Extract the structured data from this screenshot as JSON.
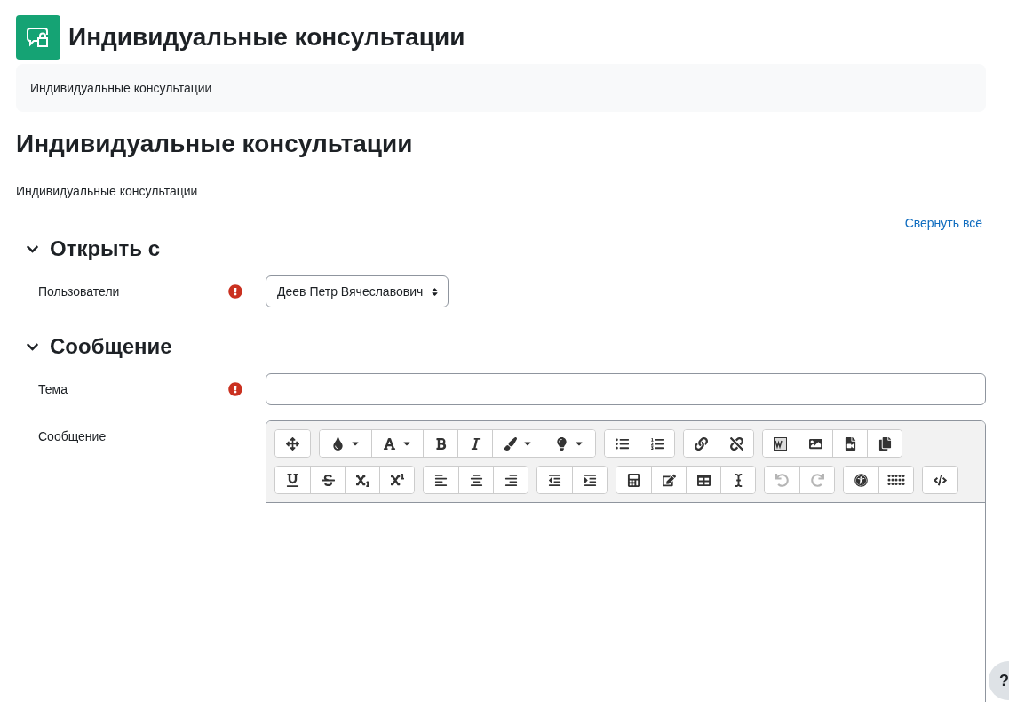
{
  "header": {
    "title": "Индивидуальные консультации"
  },
  "description_box": {
    "text": "Индивидуальные консультации"
  },
  "heading": "Индивидуальные консультации",
  "intro": "Индивидуальные консультации",
  "collapse_link": "Свернуть всё",
  "sections": [
    {
      "title": "Открыть с",
      "expanded": true,
      "fields": [
        {
          "kind": "select",
          "label": "Пользователи",
          "required": true,
          "value": "Деев Петр Вячеславович"
        }
      ]
    },
    {
      "title": "Сообщение",
      "expanded": true,
      "fields": [
        {
          "kind": "text",
          "label": "Тема",
          "required": true
        },
        {
          "kind": "editor",
          "label": "Сообщение",
          "required": false,
          "toolbar": [
            [
              [
                {
                  "dropdown": false,
                  "disabled": false
                }
              ],
              [
                {
                  "dropdown": true,
                  "disabled": false
                },
                {
                  "dropdown": true,
                  "disabled": false
                },
                {
                  "dropdown": false,
                  "disabled": false
                },
                {
                  "dropdown": false,
                  "disabled": false
                },
                {
                  "dropdown": true,
                  "disabled": false
                },
                {
                  "dropdown": true,
                  "disabled": false
                }
              ],
              [
                {
                  "dropdown": false,
                  "disabled": false
                },
                {
                  "dropdown": false,
                  "disabled": false
                }
              ],
              [
                {
                  "dropdown": false,
                  "disabled": false
                },
                {
                  "dropdown": false,
                  "disabled": false
                }
              ],
              [
                {
                  "dropdown": false,
                  "disabled": false
                },
                {
                  "dropdown": false,
                  "disabled": false
                },
                {
                  "dropdown": false,
                  "disabled": false
                },
                {
                  "dropdown": false,
                  "disabled": false
                }
              ]
            ],
            [
              [
                {
                  "dropdown": false,
                  "disabled": false
                },
                {
                  "dropdown": false,
                  "disabled": false
                },
                {
                  "dropdown": false,
                  "disabled": false
                },
                {
                  "dropdown": false,
                  "disabled": false
                }
              ],
              [
                {
                  "dropdown": false,
                  "disabled": false
                },
                {
                  "dropdown": false,
                  "disabled": false
                },
                {
                  "dropdown": false,
                  "disabled": false
                }
              ],
              [
                {
                  "dropdown": false,
                  "disabled": false
                },
                {
                  "dropdown": false,
                  "disabled": false
                }
              ],
              [
                {
                  "dropdown": false,
                  "disabled": false
                },
                {
                  "dropdown": false,
                  "disabled": false
                },
                {
                  "dropdown": false,
                  "disabled": false
                },
                {
                  "dropdown": false,
                  "disabled": false
                }
              ],
              [
                {
                  "dropdown": false,
                  "disabled": true
                },
                {
                  "dropdown": false,
                  "disabled": true
                }
              ],
              [
                {
                  "dropdown": false,
                  "disabled": false
                },
                {
                  "dropdown": false,
                  "disabled": false
                }
              ],
              [
                {
                  "dropdown": false,
                  "disabled": false
                }
              ]
            ]
          ]
        }
      ]
    }
  ],
  "help_button": "?"
}
